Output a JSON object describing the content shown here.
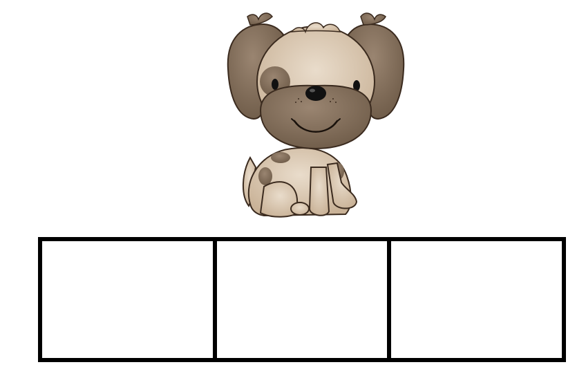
{
  "picture": {
    "icon": "puppy-icon",
    "colors": {
      "fur_light": "#d9c5ae",
      "fur_dark": "#84705b",
      "outline": "#3a2a1e",
      "nose": "#111111"
    }
  },
  "letter_boxes": {
    "count": 3,
    "border_color": "#000000",
    "values": [
      "",
      "",
      ""
    ]
  }
}
